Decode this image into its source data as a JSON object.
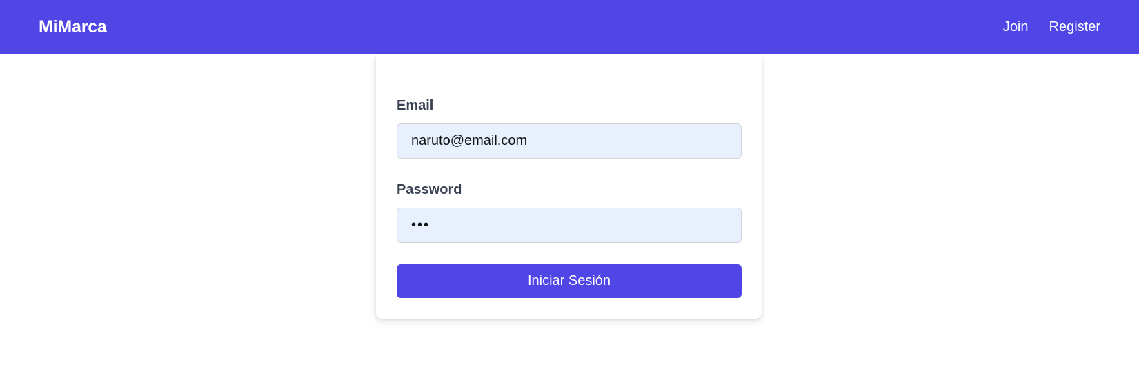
{
  "navbar": {
    "brand": "MiMarca",
    "links": [
      {
        "label": "Join"
      },
      {
        "label": "Register"
      }
    ]
  },
  "login_form": {
    "email_label": "Email",
    "email_value": "naruto@email.com",
    "password_label": "Password",
    "password_value": "abc",
    "submit_label": "Iniciar Sesión"
  },
  "colors": {
    "primary": "#4f46e5",
    "input_background": "#e8f0fe",
    "label_text": "#374151"
  }
}
